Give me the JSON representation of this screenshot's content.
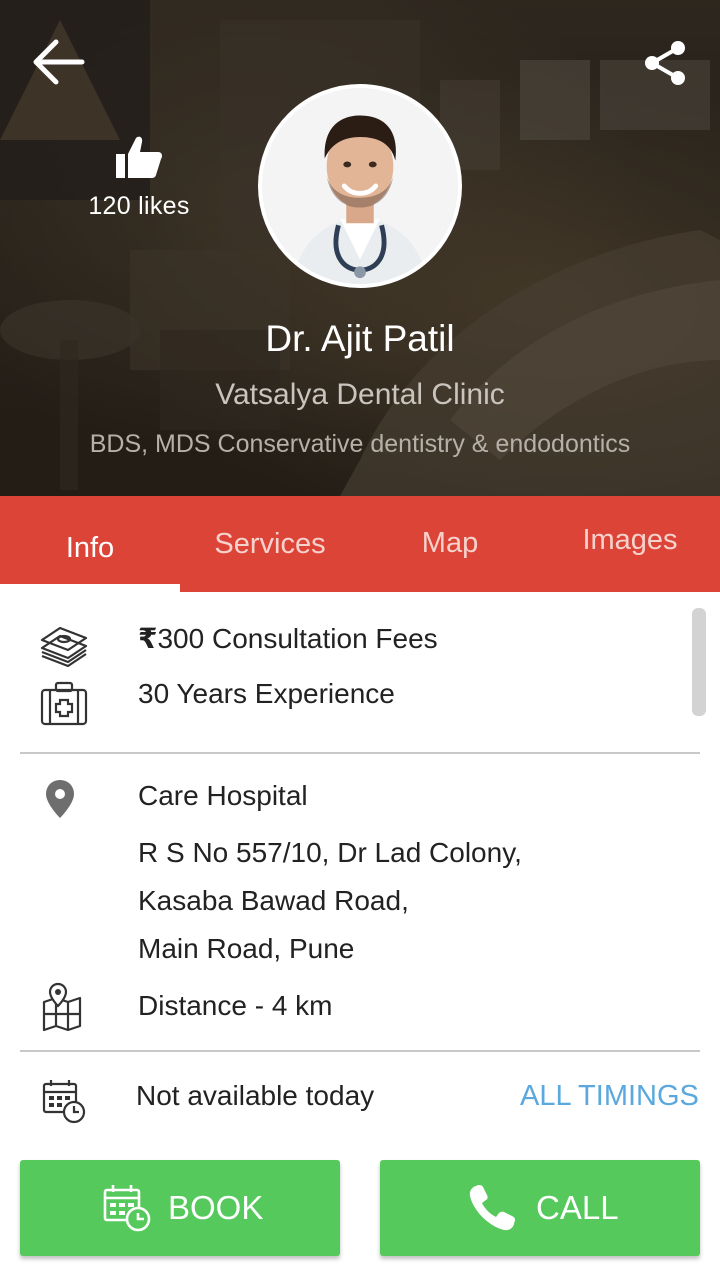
{
  "header": {
    "back_icon": "arrow-left-icon",
    "share_icon": "share-icon",
    "likes": {
      "icon": "thumbs-up-icon",
      "count_label": "120 likes"
    },
    "doctor": {
      "name": "Dr. Ajit Patil",
      "clinic": "Vatsalya Dental Clinic",
      "qualification": "BDS, MDS Conservative dentistry & endodontics"
    }
  },
  "tabs": [
    {
      "label": "Info",
      "active": true
    },
    {
      "label": "Services",
      "active": false
    },
    {
      "label": "Map",
      "active": false
    },
    {
      "label": "Images",
      "active": false
    }
  ],
  "info": {
    "fees": {
      "icon": "money-stack-icon",
      "currency_symbol": "₹",
      "text": "300 Consultation Fees"
    },
    "experience": {
      "icon": "medical-kit-icon",
      "text": "30 Years Experience"
    },
    "location": {
      "icon": "map-pin-icon",
      "hospital": "Care Hospital",
      "address_lines": [
        "R S No 557/10, Dr Lad Colony,",
        "Kasaba Bawad Road,",
        "Main Road, Pune"
      ]
    },
    "distance": {
      "icon": "map-icon",
      "text": "Distance - 4 km"
    },
    "availability": {
      "icon": "calendar-clock-icon",
      "text": "Not available today",
      "link_label": "ALL TIMINGS"
    }
  },
  "actions": {
    "book": {
      "label": "BOOK",
      "icon": "calendar-clock-icon"
    },
    "call": {
      "label": "CALL",
      "icon": "phone-icon"
    }
  },
  "colors": {
    "tab_bar": "#dd4438",
    "action_green": "#55c95b",
    "link_blue": "#5aa8dd"
  }
}
